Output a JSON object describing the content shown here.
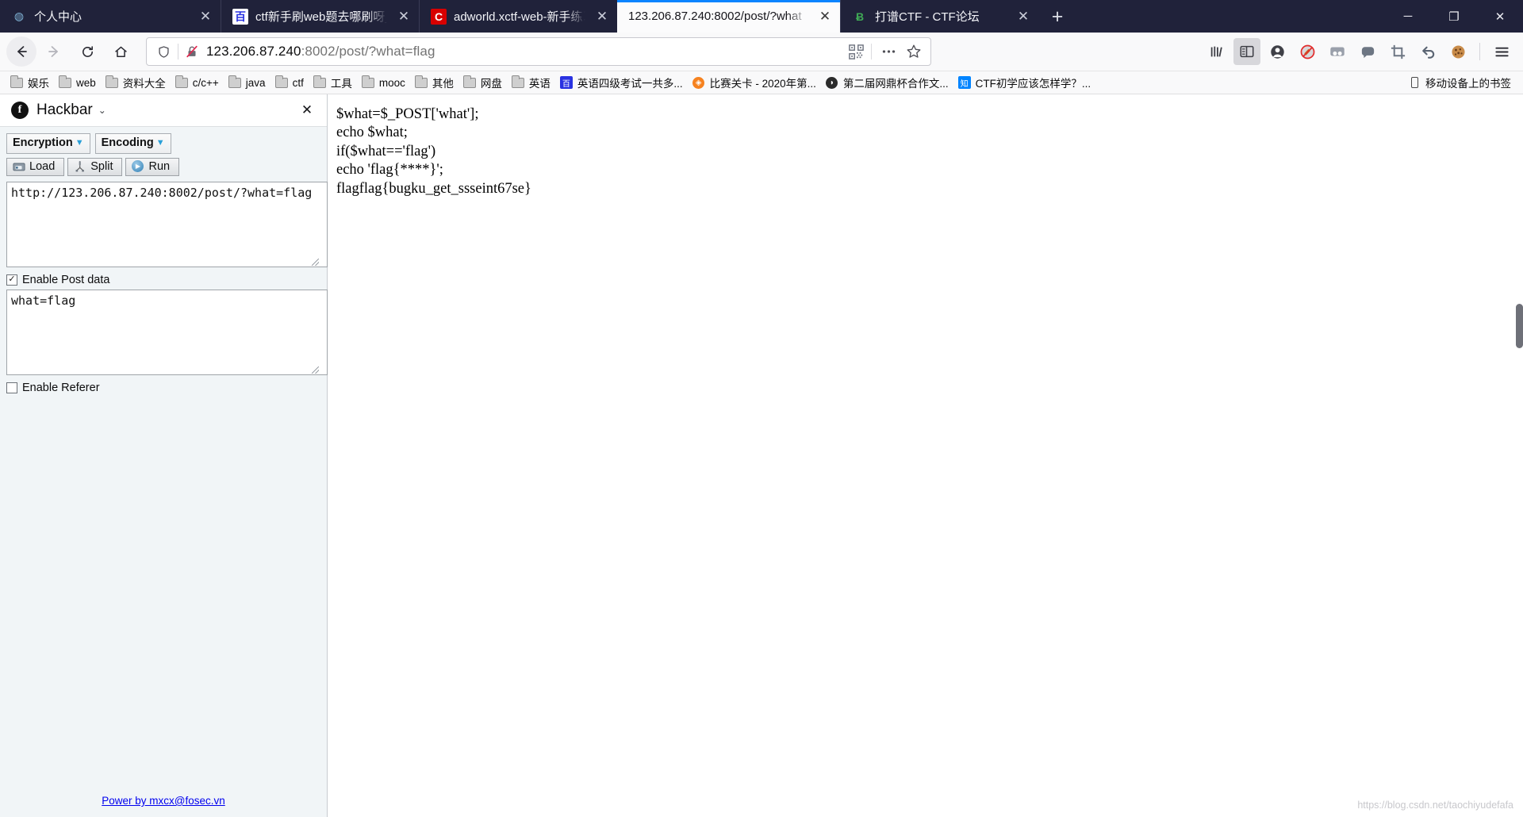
{
  "browser": {
    "tabs": [
      {
        "title": "个人中心",
        "favicon": "user-circle-icon",
        "active": false,
        "close_label": "✕"
      },
      {
        "title": "ctf新手刷web题去哪刷呀_百度",
        "favicon": "baidu-icon",
        "active": false,
        "close_label": "✕"
      },
      {
        "title": "adworld.xctf-web-新手练习区",
        "favicon": "csdn-icon",
        "active": false,
        "close_label": "✕"
      },
      {
        "title": "123.206.87.240:8002/post/?what",
        "favicon": "none",
        "active": true,
        "close_label": "✕"
      },
      {
        "title": "打谱CTF - CTF论坛",
        "favicon": "bbs-icon",
        "active": false,
        "close_label": "✕"
      }
    ],
    "new_tab_label": "+",
    "window_controls": {
      "minimize": "─",
      "maximize": "❐",
      "close": "✕"
    },
    "nav": {
      "back": "←",
      "forward": "→",
      "reload": "⟳",
      "home": "⌂"
    },
    "urlbar": {
      "shield_icon": "shield-icon",
      "security_icon": "broken-lock-icon",
      "url_host": "123.206.87.240",
      "url_rest": ":8002/post/?what=flag",
      "full_url": "123.206.87.240:8002/post/?what=flag",
      "qr_icon": "qrcode-icon",
      "more_icon": "ellipsis-icon",
      "bookmark_icon": "star-icon"
    },
    "toolbar_icons": [
      {
        "name": "library-icon",
        "glyph": "|||\\",
        "selected": false
      },
      {
        "name": "sidebar-toggle-icon",
        "glyph": "▤",
        "selected": true
      },
      {
        "name": "account-icon",
        "glyph": "☺",
        "selected": false
      },
      {
        "name": "adblock-disabled-icon",
        "glyph": "⃠",
        "selected": false
      },
      {
        "name": "tab-group-icon",
        "glyph": "▭",
        "selected": false
      },
      {
        "name": "chat-bubble-icon",
        "glyph": "💬",
        "selected": false
      },
      {
        "name": "crop-screenshot-icon",
        "glyph": "⛶",
        "selected": false
      },
      {
        "name": "undo-arrow-icon",
        "glyph": "↩",
        "selected": false
      },
      {
        "name": "cookie-icon",
        "glyph": "🍪",
        "selected": false
      },
      {
        "name": "hamburger-menu-icon",
        "glyph": "☰",
        "selected": false
      }
    ],
    "bookmarks": [
      {
        "label": "娱乐",
        "icon": "folder-icon"
      },
      {
        "label": "web",
        "icon": "folder-icon"
      },
      {
        "label": "资料大全",
        "icon": "folder-icon"
      },
      {
        "label": "c/c++",
        "icon": "folder-icon"
      },
      {
        "label": "java",
        "icon": "folder-icon"
      },
      {
        "label": "ctf",
        "icon": "folder-icon"
      },
      {
        "label": "工具",
        "icon": "folder-icon"
      },
      {
        "label": "mooc",
        "icon": "folder-icon"
      },
      {
        "label": "其他",
        "icon": "folder-icon"
      },
      {
        "label": "网盘",
        "icon": "folder-icon"
      },
      {
        "label": "英语",
        "icon": "folder-icon"
      },
      {
        "label": "英语四级考试一共多...",
        "icon": "baidu-icon"
      },
      {
        "label": "比赛关卡 - 2020年第...",
        "icon": "orange-site-icon"
      },
      {
        "label": "第二届网鼎杯合作文...",
        "icon": "dark-site-icon"
      },
      {
        "label": "CTF初学应该怎样学？...",
        "icon": "zhihu-icon"
      }
    ],
    "bookmarks_mobile": {
      "label": "移动设备上的书签",
      "icon": "phone-icon"
    }
  },
  "sidebar": {
    "logo": "f",
    "title": "Hackbar",
    "caret": "⌄",
    "close": "✕",
    "buttons_row1": [
      {
        "label": "Encryption",
        "caret": "▼"
      },
      {
        "label": "Encoding",
        "caret": "▼"
      }
    ],
    "buttons_row2": [
      {
        "label": "Load",
        "icon": "load-icon"
      },
      {
        "label": "Split",
        "icon": "split-icon"
      },
      {
        "label": "Run",
        "icon": "run-icon"
      }
    ],
    "url_textarea": {
      "value": "http://123.206.87.240:8002/post/?what=flag",
      "placeholder": ""
    },
    "enable_post_data": {
      "label": "Enable Post data",
      "checked": true,
      "check_glyph": "✓"
    },
    "post_textarea": {
      "value": "what=flag",
      "placeholder": ""
    },
    "enable_referer": {
      "label": "Enable Referer",
      "checked": false,
      "check_glyph": ""
    },
    "footer_link": "Power by mxcx@fosec.vn"
  },
  "page": {
    "output_lines": [
      "$what=$_POST['what'];",
      "echo $what;",
      "if($what=='flag')",
      "echo 'flag{****}';",
      "flagflag{bugku_get_ssseint67se}"
    ],
    "output_text": "$what=$_POST['what'];\necho $what;\nif($what=='flag')\necho 'flag{****}';\nflagflag{bugku_get_ssseint67se}",
    "watermark": "https://blog.csdn.net/taochiyudefafa"
  }
}
